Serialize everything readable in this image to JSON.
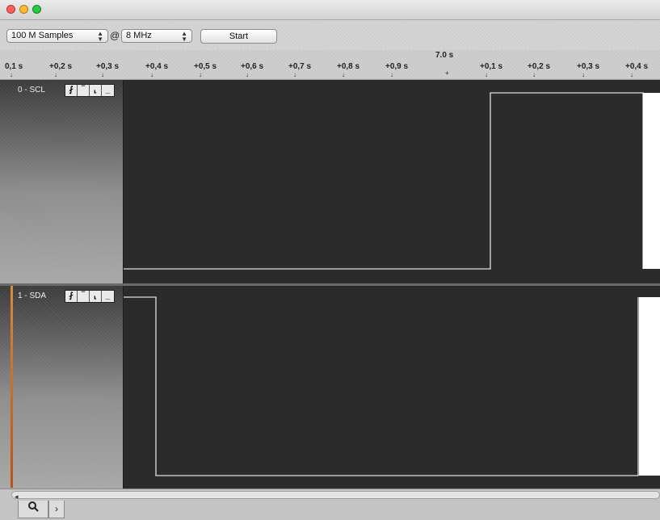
{
  "window": {
    "traffic_lights": [
      "#ff5f57",
      "#ffbd2e",
      "#28c940"
    ]
  },
  "toolbar": {
    "samples_value": "100 M Samples",
    "at_symbol": "@",
    "rate_value": "8 MHz",
    "start_label": "Start"
  },
  "ruler": {
    "center_label": "7.0 s",
    "ticks": [
      "0,1 s",
      "+0,2 s",
      "+0,3 s",
      "+0,4 s",
      "+0,5 s",
      "+0,6 s",
      "+0,7 s",
      "+0,8 s",
      "+0,9 s",
      "+0,1 s",
      "+0,2 s",
      "+0,3 s",
      "+0,4 s"
    ]
  },
  "channels": [
    {
      "name": "0 - SCL",
      "trigger_buttons": [
        "rising-edge",
        "high",
        "falling-edge",
        "low"
      ]
    },
    {
      "name": "1 - SDA",
      "trigger_buttons": [
        "rising-edge",
        "high",
        "falling-edge",
        "low"
      ]
    }
  ],
  "bottom": {
    "tab_search_icon": "search-icon",
    "tab_next_icon": "chevron-right-icon"
  },
  "colors": {
    "plot_bg": "#2b2b2b",
    "signal": "#e0e0e0",
    "sda_strip": "#c8701f"
  }
}
